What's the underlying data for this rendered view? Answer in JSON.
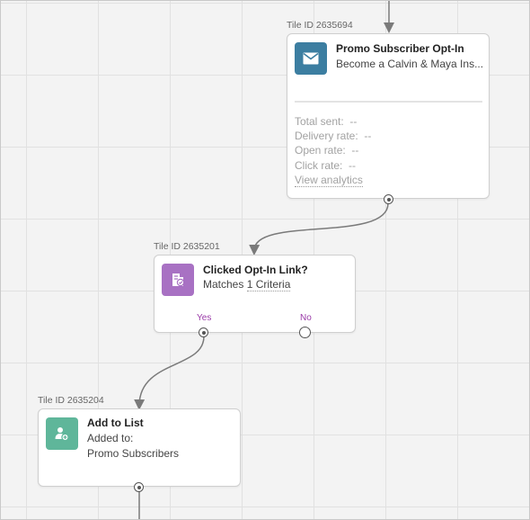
{
  "colors": {
    "email_icon_bg": "#3c7ea1",
    "condition_icon_bg": "#a871c3",
    "list_icon_bg": "#5fb69a",
    "branch_label": "#9a3aa8"
  },
  "tiles": {
    "email": {
      "tile_id": "Tile ID 2635694",
      "icon": "envelope-icon",
      "title": "Promo Subscriber Opt-In",
      "subtitle": "Become a Calvin & Maya Ins...",
      "stats": [
        {
          "label": "Total sent:",
          "value": "--"
        },
        {
          "label": "Delivery rate:",
          "value": "--"
        },
        {
          "label": "Open rate:",
          "value": "--"
        },
        {
          "label": "Click rate:",
          "value": "--"
        }
      ],
      "analytics_link": "View analytics"
    },
    "condition": {
      "tile_id": "Tile ID 2635201",
      "icon": "condition-check-icon",
      "title": "Clicked Opt-In Link?",
      "matches_prefix": "Matches",
      "matches_link": "1 Criteria",
      "yes_label": "Yes",
      "no_label": "No"
    },
    "add_list": {
      "tile_id": "Tile ID 2635204",
      "icon": "add-person-icon",
      "title": "Add to List",
      "subtitle_1": "Added to:",
      "subtitle_2": "Promo Subscribers"
    }
  }
}
